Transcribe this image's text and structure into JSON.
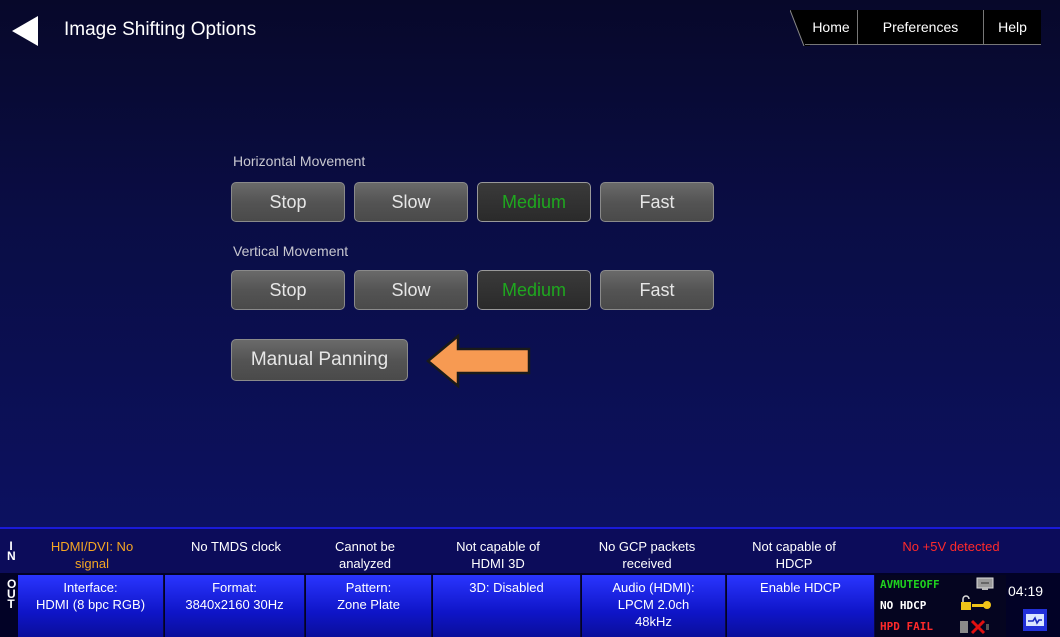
{
  "header": {
    "title": "Image Shifting Options",
    "tabs": {
      "home": "Home",
      "preferences": "Preferences",
      "help": "Help"
    }
  },
  "horizontal": {
    "label": "Horizontal Movement",
    "buttons": [
      "Stop",
      "Slow",
      "Medium",
      "Fast"
    ],
    "selected": "Medium"
  },
  "vertical": {
    "label": "Vertical Movement",
    "buttons": [
      "Stop",
      "Slow",
      "Medium",
      "Fast"
    ],
    "selected": "Medium"
  },
  "manual_panning": "Manual Panning",
  "in_status": {
    "side": "IN",
    "cells": [
      {
        "line1": "HDMI/DVI: No",
        "line2": "signal",
        "color": "#f5a623"
      },
      {
        "line1": "No TMDS clock",
        "line2": "",
        "color": "#ffffff"
      },
      {
        "line1": "Cannot be",
        "line2": "analyzed",
        "color": "#ffffff"
      },
      {
        "line1": "Not capable of",
        "line2": "HDMI 3D",
        "color": "#ffffff"
      },
      {
        "line1": "No GCP packets",
        "line2": "received",
        "color": "#ffffff"
      },
      {
        "line1": "Not capable of",
        "line2": "HDCP",
        "color": "#ffffff"
      },
      {
        "line1": "No +5V detected",
        "line2": "",
        "color": "#ff2a2a"
      }
    ]
  },
  "out_status": {
    "side": "OUT",
    "cells": [
      {
        "line1": "Interface:",
        "line2": "HDMI (8 bpc RGB)",
        "line3": ""
      },
      {
        "line1": "Format:",
        "line2": "3840x2160 30Hz",
        "line3": ""
      },
      {
        "line1": "Pattern:",
        "line2": "Zone Plate",
        "line3": ""
      },
      {
        "line1": "3D: Disabled",
        "line2": "",
        "line3": ""
      },
      {
        "line1": "Audio (HDMI):",
        "line2": "LPCM 2.0ch",
        "line3": "48kHz"
      },
      {
        "line1": "Enable HDCP",
        "line2": "",
        "line3": ""
      }
    ],
    "hw": {
      "avmute": "AVMUTEOFF",
      "hdcp": "NO HDCP",
      "hpd": "HPD FAIL"
    },
    "time": "04:19"
  },
  "colors": {
    "selected_text": "#1fa81f",
    "arrow": "#f79a52",
    "in_warning": "#f5a623",
    "error": "#ff2a2a",
    "avmute": "#1fd11f"
  },
  "icons": [
    "back-arrow-icon",
    "orange-arrow-icon",
    "monitor-icon",
    "lock-key-icon",
    "x-icon",
    "port-icon"
  ]
}
